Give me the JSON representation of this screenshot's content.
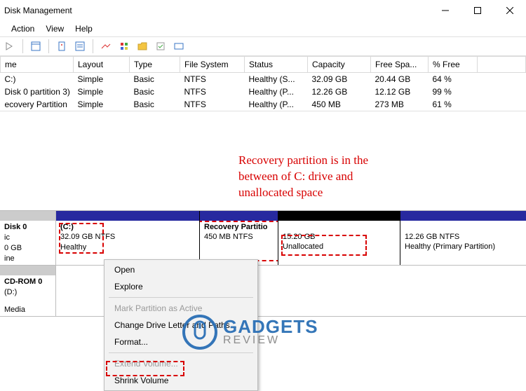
{
  "window": {
    "title": "Disk Management"
  },
  "menu": {
    "action": "Action",
    "view": "View",
    "help": "Help"
  },
  "table": {
    "headers": {
      "name": "me",
      "layout": "Layout",
      "type": "Type",
      "fs": "File System",
      "status": "Status",
      "capacity": "Capacity",
      "free": "Free Spa...",
      "pct": "% Free"
    },
    "rows": [
      {
        "name": "C:)",
        "layout": "Simple",
        "type": "Basic",
        "fs": "NTFS",
        "status": "Healthy (S...",
        "capacity": "32.09 GB",
        "free": "20.44 GB",
        "pct": "64 %"
      },
      {
        "name": "Disk 0 partition 3)",
        "layout": "Simple",
        "type": "Basic",
        "fs": "NTFS",
        "status": "Healthy (P...",
        "capacity": "12.26 GB",
        "free": "12.12 GB",
        "pct": "99 %"
      },
      {
        "name": "ecovery Partition",
        "layout": "Simple",
        "type": "Basic",
        "fs": "NTFS",
        "status": "Healthy (P...",
        "capacity": "450 MB",
        "free": "273 MB",
        "pct": "61 %"
      }
    ]
  },
  "annotation": {
    "line1": "Recovery partition is in the",
    "line2": "between of C: drive and",
    "line3": "unallocated space"
  },
  "disks": {
    "d0": {
      "name": "Disk 0",
      "l2": "ic",
      "l3": "0 GB",
      "l4": "ine"
    },
    "cd": {
      "name": "CD-ROM 0",
      "l2": "(D:)",
      "l3": "Media"
    }
  },
  "partitions": {
    "c": {
      "title": "(C:)",
      "size": "32.09 GB NTFS",
      "status": "Healthy"
    },
    "rec": {
      "title": "Recovery Partitio",
      "size": "450 MB NTFS"
    },
    "un": {
      "size": "15.20 GB",
      "status": "Unallocated"
    },
    "p3": {
      "size": "12.26 GB NTFS",
      "status": "Healthy (Primary Partition)"
    }
  },
  "ctx": {
    "open": "Open",
    "explore": "Explore",
    "mark": "Mark Partition as Active",
    "change": "Change Drive Letter and Paths...",
    "format": "Format...",
    "extend": "Extend Volume...",
    "shrink": "Shrink Volume"
  },
  "watermark": {
    "top": "GADGETS",
    "bottom": "REVIEW"
  }
}
